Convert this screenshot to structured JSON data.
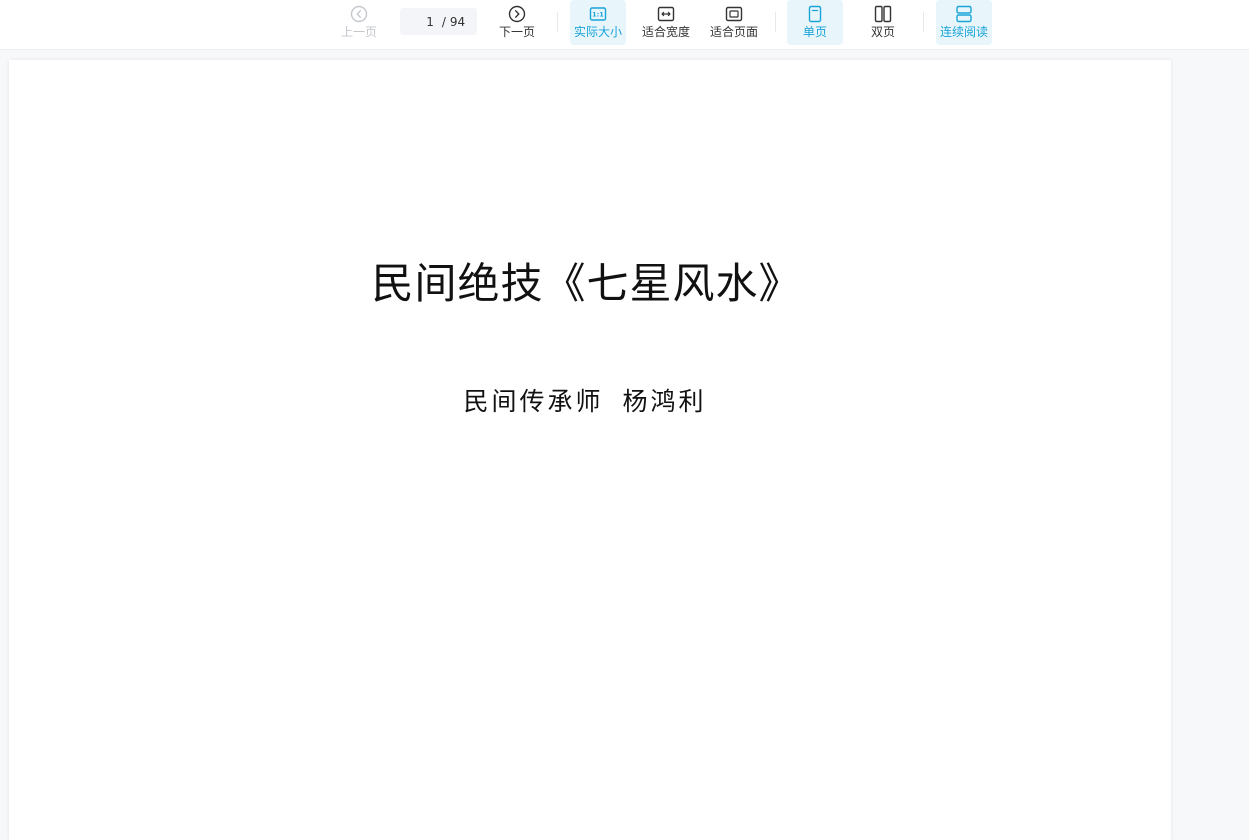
{
  "toolbar": {
    "prev_label": "上一页",
    "next_label": "下一页",
    "page_current": "1",
    "page_total": "94",
    "actual_size_label": "实际大小",
    "fit_width_label": "适合宽度",
    "fit_page_label": "适合页面",
    "single_page_label": "单页",
    "double_page_label": "双页",
    "continuous_label": "连续阅读",
    "accent_color": "#1aa3d8"
  },
  "document": {
    "title": "民间绝技《七星风水》",
    "author": "民间传承师 杨鸿利"
  }
}
